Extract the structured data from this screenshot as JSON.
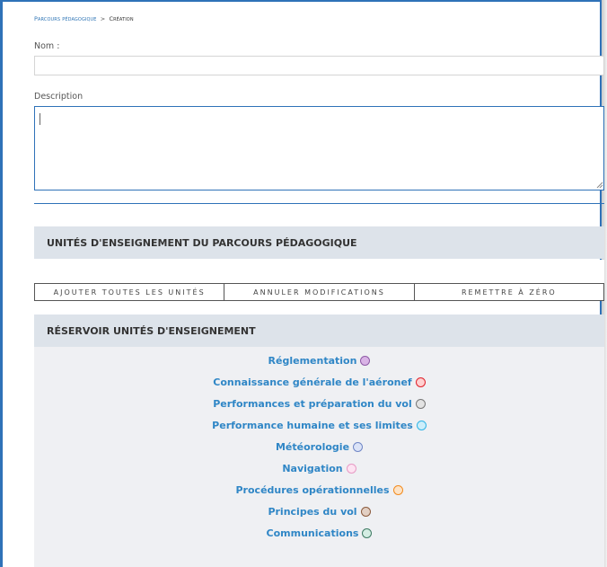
{
  "breadcrumb": {
    "root": "Parcours pédagogique",
    "separator": ">",
    "current": "Création"
  },
  "form": {
    "name_label": "Nom :",
    "name_value": "",
    "description_label": "Description",
    "description_value": ""
  },
  "selected_panel": {
    "title": "UNITÉS D'ENSEIGNEMENT DU PARCOURS PÉDAGOGIQUE"
  },
  "actions": {
    "add_all": "AJOUTER TOUTES LES UNITÉS",
    "cancel": "ANNULER MODIFICATIONS",
    "reset": "REMETTRE À ZÉRO"
  },
  "pool": {
    "title": "RÉSERVOIR UNITÉS D'ENSEIGNEMENT",
    "units": [
      {
        "label": "Réglementation",
        "color": "#d9b3e6",
        "border": "#8e5aa6"
      },
      {
        "label": "Connaissance générale de l'aéronef",
        "color": "#ffd0d0",
        "border": "#e0202a"
      },
      {
        "label": "Performances et préparation du vol",
        "color": "#e3e3e3",
        "border": "#777777"
      },
      {
        "label": "Performance humaine et ses limites",
        "color": "#cdeefa",
        "border": "#2fb4e6"
      },
      {
        "label": "Météorologie",
        "color": "#dbe3f7",
        "border": "#6f86c6"
      },
      {
        "label": "Navigation",
        "color": "#fde3f2",
        "border": "#e79ac4"
      },
      {
        "label": "Procédures opérationnelles",
        "color": "#fde3c6",
        "border": "#f28b1e"
      },
      {
        "label": "Principes du vol",
        "color": "#e2cfc3",
        "border": "#8b5a3c"
      },
      {
        "label": "Communications",
        "color": "#d4ede3",
        "border": "#3e7a62"
      }
    ]
  }
}
